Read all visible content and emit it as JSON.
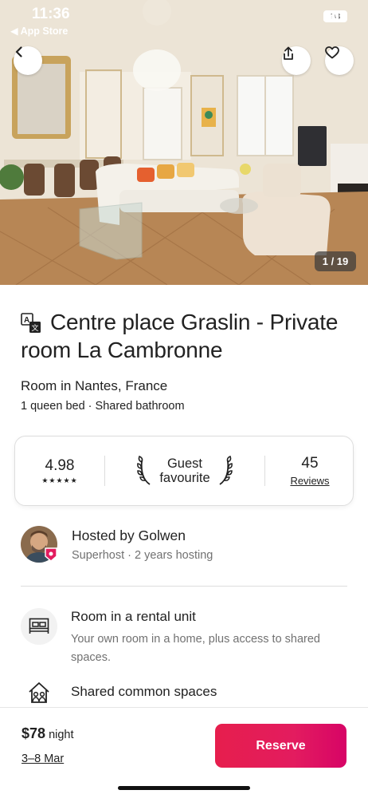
{
  "status_bar": {
    "time": "11:36",
    "back_label": "◀ App Store",
    "battery": "98"
  },
  "gallery": {
    "counter": "1 / 19",
    "icons": [
      "back-arrow",
      "share",
      "heart"
    ]
  },
  "listing": {
    "title": "Centre place Graslin - Private room La Cambronne",
    "subtitle": "Room in Nantes, France",
    "details": "1 queen bed · Shared bathroom"
  },
  "rating": {
    "score": "4.98",
    "stars": "★★★★★",
    "guest_favourite": "Guest\nfavourite",
    "reviews_count": "45",
    "reviews_label": "Reviews"
  },
  "host": {
    "name": "Hosted by Golwen",
    "meta": "Superhost · 2 years hosting"
  },
  "features": [
    {
      "title": "Room in a rental unit",
      "description": "Your own room in a home, plus access to shared spaces.",
      "icon": "bed-room-icon"
    },
    {
      "title": "Shared common spaces",
      "description": "",
      "icon": "shared-home-icon"
    }
  ],
  "booking": {
    "price": "$78",
    "price_unit": "night",
    "dates": "3–8 Mar",
    "reserve_label": "Reserve"
  },
  "colors": {
    "accent": "#e31c5f",
    "text": "#222222",
    "muted": "#717171"
  }
}
